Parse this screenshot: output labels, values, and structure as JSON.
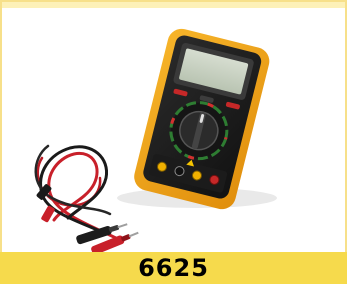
{
  "product": {
    "code": "6625"
  },
  "colors": {
    "caption_background": "#f6da4c",
    "border": "#f7e08a",
    "device_body": "#f2a516",
    "device_face": "#1e1e1e",
    "display": "#c9d3c3",
    "lead_red": "#c8202a",
    "lead_black": "#1a1a1a"
  },
  "icons": {
    "product_image": "multimeter-with-test-leads"
  }
}
